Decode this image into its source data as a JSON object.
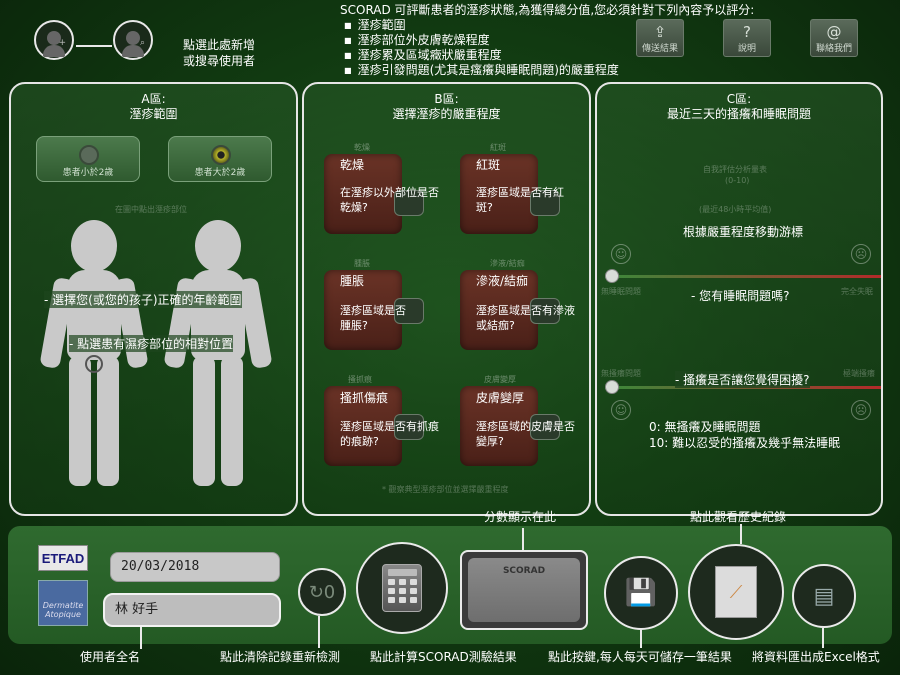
{
  "header": {
    "user_hint_line1": "點選此處新增",
    "user_hint_line2": "或搜尋使用者",
    "intro_title": "SCORAD 可評斷患者的溼疹狀態,為獲得總分值,您必須針對下列內容予以評分:",
    "intro_items": [
      "溼疹範圍",
      "溼疹部位外皮膚乾燥程度",
      "溼疹累及區域癥狀嚴重程度",
      "溼疹引發問題(尤其是瘙癢與睡眠問題)的嚴重程度"
    ],
    "buttons": [
      {
        "label": "傳送結果",
        "icon": "share-icon"
      },
      {
        "label": "說明",
        "icon": "help-icon"
      },
      {
        "label": "聯絡我們",
        "icon": "email-icon"
      }
    ]
  },
  "panel_a": {
    "title_line1": "A區:",
    "title_line2": "溼疹範圍",
    "age_under": "患者小於2歲",
    "age_over": "患者大於2歲",
    "faint_hint": "在圖中點出溼疹部位",
    "instr1": "- 選擇您(或您的孩子)正確的年齡範圍",
    "instr2": "- 點選患有濕疹部位的相對位置"
  },
  "panel_b": {
    "title_line1": "B區:",
    "title_line2": "選擇溼疹的嚴重程度",
    "cards": [
      {
        "label": "乾燥",
        "name": "乾燥",
        "question": "在溼疹以外部位是否乾燥?"
      },
      {
        "label": "紅斑",
        "name": "紅斑",
        "question": "溼疹區域是否有紅斑?"
      },
      {
        "label": "腫脹",
        "name": "腫脹",
        "question": "溼疹區域是否腫脹?"
      },
      {
        "label": "滲液/結痂",
        "name": "滲液/結痂",
        "question": "溼疹區域是否有滲液或結痂?"
      },
      {
        "label": "搔抓痕",
        "name": "搔抓傷痕",
        "question": "溼疹區域是否有抓痕的痕跡?"
      },
      {
        "label": "皮膚變厚",
        "name": "皮膚變厚",
        "question": "溼疹區域的皮膚是否變厚?"
      }
    ],
    "footer": "* 觀察典型溼疹部位並選擇嚴重程度"
  },
  "panel_c": {
    "title_line1": "C區:",
    "title_line2": "最近三天的搔癢和睡眠問題",
    "faint1": "自我評估分析量表",
    "faint2": "(0-10)",
    "faint3": "(最近48小時平均值)",
    "instruction": "根據嚴重程度移動游標",
    "sleep_left": "無睡眠問題",
    "sleep_right": "完全失眠",
    "sleep_question": "- 您有睡眠問題嗎?",
    "itch_left": "無搔癢問題",
    "itch_right": "極端搔癢",
    "itch_question": "- 搔癢是否讓您覺得困擾?",
    "sleep_value": 0,
    "itch_value": 0,
    "legend0": "0: 無搔癢及睡眠問題",
    "legend10": "10: 難以忍受的搔癢及幾乎無法睡眠"
  },
  "bottom": {
    "logo1": "ETFAD",
    "logo2": "Dermatite Atopique",
    "date": "20/03/2018",
    "name": "林 好手",
    "score_label": "SCORAD",
    "callout_score": "分數顯示在此",
    "callout_history": "點此觀看歷史紀錄",
    "cap_name": "使用者全名",
    "cap_reset": "點此清除記錄重新檢測",
    "cap_calc": "點此計算SCORAD測驗結果",
    "cap_save": "點此按鍵,每人每天可儲存一筆結果",
    "cap_excel": "將資料匯出成Excel格式"
  },
  "colors": {
    "background": "#123d12",
    "panel_border": "#e6e6e6",
    "card": "#6a3326",
    "slider_red": "#b32a2a",
    "slider_green": "#3a8a3a"
  }
}
